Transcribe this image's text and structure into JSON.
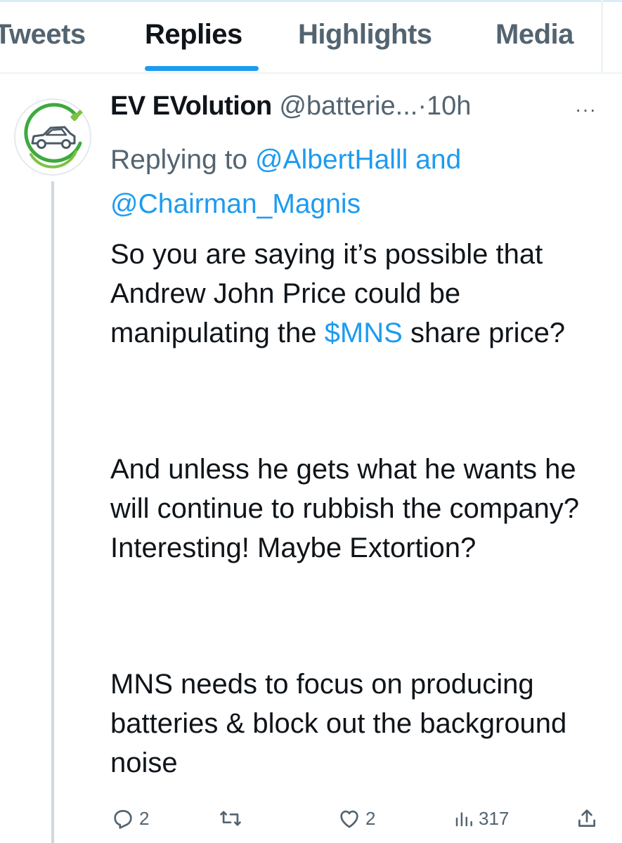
{
  "tabs": [
    {
      "label": "Tweets",
      "visible_label": "Tweets"
    },
    {
      "label": "Replies"
    },
    {
      "label": "Highlights"
    },
    {
      "label": "Media"
    }
  ],
  "active_tab": "Replies",
  "tweet": {
    "display_name": "EV EVolution",
    "handle": "@batterie...",
    "separator": "·",
    "time": "10h",
    "more_label": "···",
    "replying_prefix": "Replying to",
    "replying_mention_1": "@AlbertHalll",
    "replying_and": "and",
    "replying_mention_2": "@Chairman_Magnis",
    "body_p1_before": "So you are saying it’s possible that Andrew John Price could be manipulating the",
    "body_p1_cashtag": "$MNS",
    "body_p1_after": "share price?",
    "body_p2": "And unless he gets what he wants he will continue to rubbish the company? Interesting! Maybe Extortion?",
    "body_p3": "MNS needs to focus on producing batteries & block out the background noise"
  },
  "actions": {
    "reply_count": "2",
    "retweet_count": "",
    "like_count": "2",
    "views_count": "317"
  },
  "colors": {
    "accent": "#1d9bf0",
    "text": "#0f1419",
    "muted": "#536471",
    "avatar_green": "#3daa3d"
  },
  "icons": [
    "avatar-logo",
    "more-icon",
    "reply-icon",
    "retweet-icon",
    "like-icon",
    "views-icon",
    "share-icon"
  ]
}
